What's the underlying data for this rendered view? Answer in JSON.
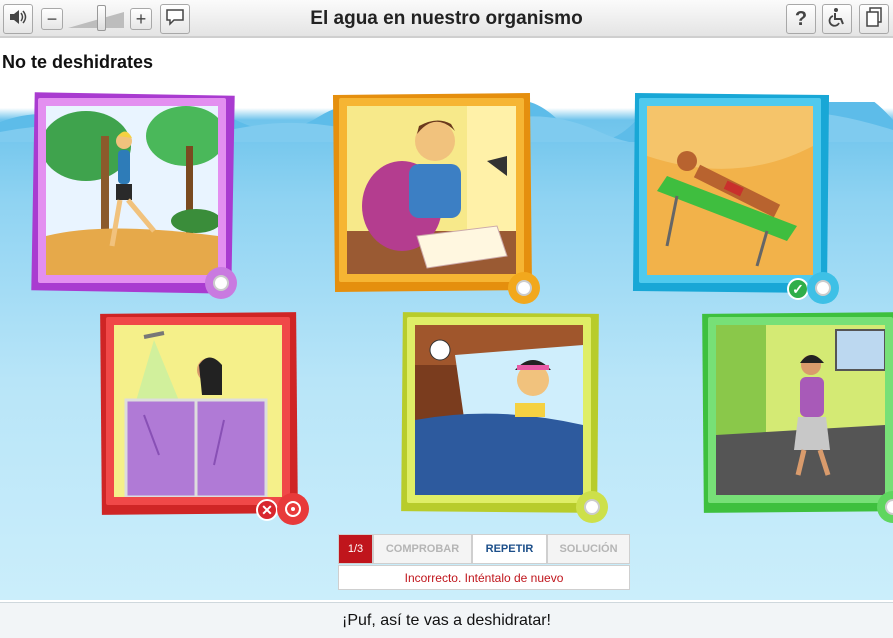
{
  "app": {
    "title": "El agua en nuestro organismo"
  },
  "toolbar": {
    "left": [
      {
        "icon": "speaker-icon",
        "name": "audio-button"
      },
      {
        "icon": "minus-icon",
        "name": "zoom-out-button",
        "glyph": "−"
      },
      {
        "icon": "plus-icon",
        "name": "zoom-in-button",
        "glyph": "+"
      },
      {
        "icon": "speech-bubble-icon",
        "name": "captions-button"
      }
    ],
    "volume_level": 0.55,
    "right": [
      {
        "icon": "question-icon",
        "name": "help-button",
        "glyph": "?"
      },
      {
        "icon": "accessibility-icon",
        "name": "accessibility-button"
      },
      {
        "icon": "document-icon",
        "name": "document-button"
      }
    ]
  },
  "activity": {
    "title": "No te deshidrates"
  },
  "cards": [
    {
      "scene": "person-running-in-park",
      "color": "#c97ae0",
      "selected": false,
      "result": null
    },
    {
      "scene": "boy-studying-at-desk",
      "color": "#f2a81d",
      "selected": false,
      "result": null
    },
    {
      "scene": "man-sunbathing-on-beach",
      "color": "#3ec0e6",
      "selected": false,
      "result": "correct"
    },
    {
      "scene": "girl-in-shower",
      "color": "#e83a3a",
      "selected": true,
      "result": "incorrect"
    },
    {
      "scene": "sick-boy-in-bed-with-fever",
      "color": "#cde04a",
      "selected": false,
      "result": null
    },
    {
      "scene": "woman-walking-on-street",
      "color": "#5fd65f",
      "selected": false,
      "result": null
    }
  ],
  "controls": {
    "counter": "1/3",
    "check_label": "COMPROBAR",
    "repeat_label": "REPETIR",
    "solution_label": "SOLUCIÓN",
    "feedback": "Incorrecto. Inténtalo de nuevo"
  },
  "footer": {
    "message": "¡Puf, así te vas a deshidratar!"
  },
  "colors": {
    "accent_red": "#c0151c",
    "repeat_blue": "#1c4f8a",
    "disabled_gray": "#b5b5b5"
  }
}
